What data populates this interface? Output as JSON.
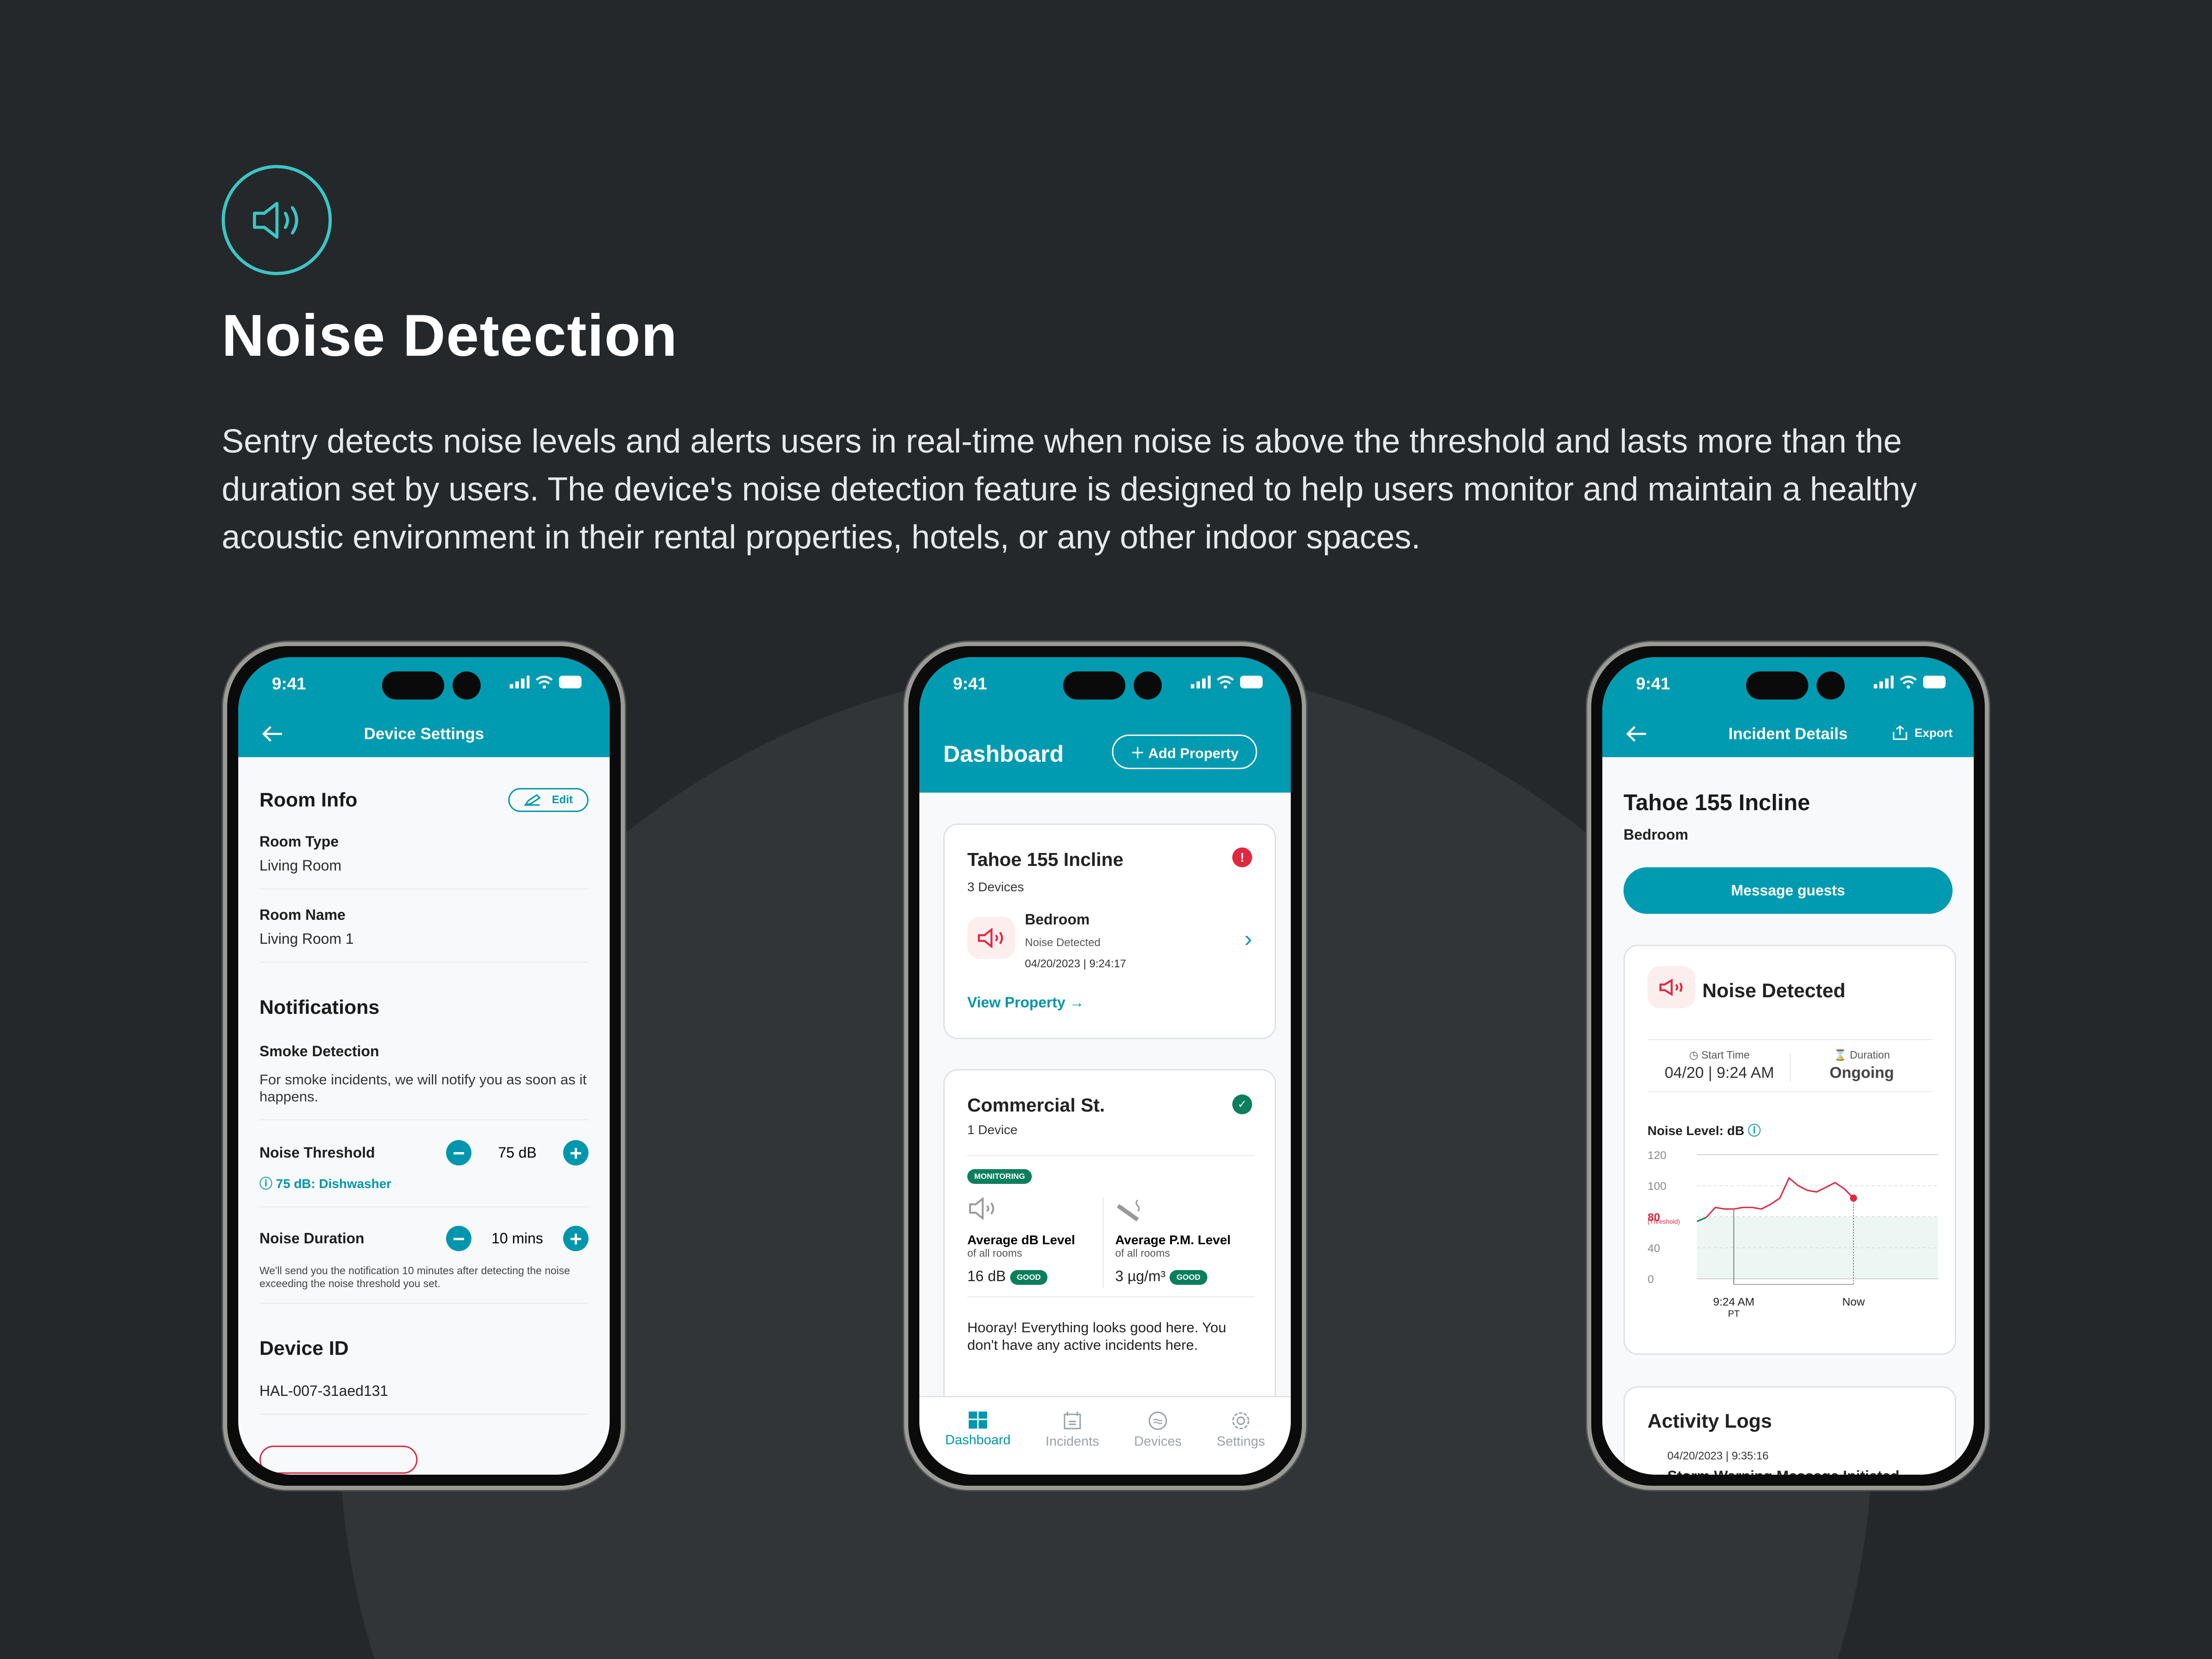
{
  "hero": {
    "icon": "speaker-icon",
    "title": "Noise Detection",
    "description": "Sentry detects noise levels and alerts users in real-time when noise is above the threshold and lasts more than the duration set by users. The device's noise detection feature is designed to help users monitor and maintain a healthy acoustic environment in their rental properties, hotels, or any other indoor spaces."
  },
  "colors": {
    "accent": "#009bb1",
    "alert": "#e0283e",
    "good": "#0b7f5c",
    "background": "#25282a"
  },
  "status_time": "9:41",
  "settings": {
    "title": "Device Settings",
    "room_info": "Room Info",
    "edit": "Edit",
    "room_type_label": "Room Type",
    "room_type": "Living Room",
    "room_name_label": "Room Name",
    "room_name": "Living Room 1",
    "notifications": "Notifications",
    "smoke_label": "Smoke Detection",
    "smoke_desc": "For smoke incidents, we will notify you as soon as it happens.",
    "threshold_label": "Noise Threshold",
    "threshold_value": "75 dB",
    "threshold_hint": "75 dB: Dishwasher",
    "duration_label": "Noise Duration",
    "duration_value": "10 mins",
    "duration_desc": "We'll send you the notification 10 minutes after detecting the noise exceeding the noise threshold you set.",
    "device_id_label": "Device ID",
    "device_id": "HAL-007-31aed131"
  },
  "dashboard": {
    "title": "Dashboard",
    "add_property": "Add Property",
    "property1": {
      "name": "Tahoe 155 Incline",
      "devices": "3 Devices",
      "room": "Bedroom",
      "event": "Noise Detected",
      "timestamp": "04/20/2023 | 9:24:17",
      "link": "View Property"
    },
    "property2": {
      "name": "Commercial St.",
      "devices": "1 Device",
      "status": "MONITORING",
      "db_label": "Average dB Level",
      "db_sub": "of all rooms",
      "db_value": "16 dB",
      "db_badge": "GOOD",
      "pm_label": "Average P.M. Level",
      "pm_sub": "of all rooms",
      "pm_value": "3 µg/m³",
      "pm_badge": "GOOD",
      "message": "Hooray! Everything looks good here. You don't have any active incidents here."
    },
    "tabs": [
      {
        "label": "Dashboard",
        "icon": "grid-icon"
      },
      {
        "label": "Incidents",
        "icon": "calendar-icon"
      },
      {
        "label": "Devices",
        "icon": "device-icon"
      },
      {
        "label": "Settings",
        "icon": "gear-icon"
      }
    ]
  },
  "incident": {
    "title": "Incident Details",
    "export": "Export",
    "property": "Tahoe 155 Incline",
    "room": "Bedroom",
    "message_button": "Message guests",
    "event": "Noise Detected",
    "start_label": "Start Time",
    "start_value": "04/20 | 9:24 AM",
    "duration_label": "Duration",
    "duration_value": "Ongoing",
    "chart_label": "Noise Level: dB",
    "activity_title": "Activity Logs",
    "activity_time": "04/20/2023 | 9:35:16",
    "activity_text": "Storm Warning Message Initiated"
  },
  "chart_data": {
    "type": "line",
    "title": "Noise Level: dB",
    "y_ticks": [
      "120",
      "100",
      "80",
      "40",
      "0"
    ],
    "threshold": 80,
    "threshold_label": "(Threshold)",
    "x_labels": [
      "9:24 AM PT",
      "Now"
    ],
    "values": [
      74,
      79,
      86,
      85,
      85,
      86,
      86,
      85,
      88,
      92,
      105,
      100,
      97,
      96,
      99,
      102,
      98,
      92
    ]
  }
}
